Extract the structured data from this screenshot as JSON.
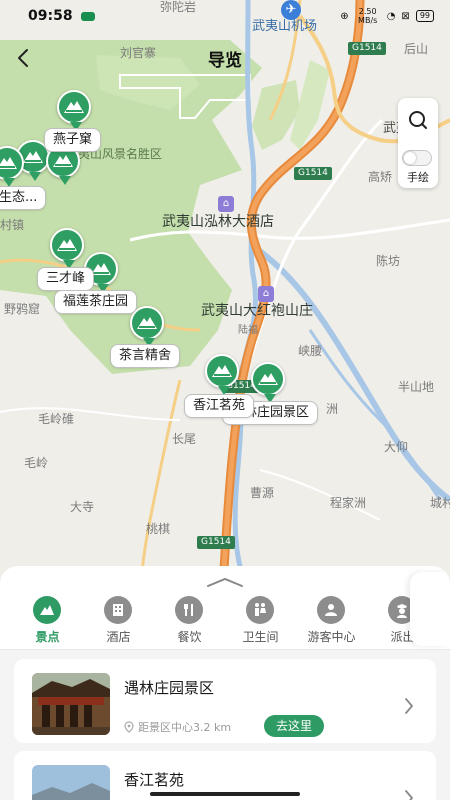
{
  "status_bar": {
    "time": "09:58",
    "net_speed": "2.50 MB/s",
    "battery": "99"
  },
  "header": {
    "title": "导览"
  },
  "tools": {
    "hand_label": "手绘"
  },
  "map": {
    "labels": {
      "mituo": "弥陀岩",
      "airport": "武夷山机场",
      "g1514": "G1514",
      "houshan": "后山",
      "liuguanzhai": "刘官寨",
      "wuyishan_right": "武夷山",
      "scenic_area": "夷山风景名胜区",
      "gaoqiao": "高矫",
      "hotel1": "武夷山泓林大酒店",
      "chenfang": "陈坊",
      "hotel2": "武夷山大红袍山庄",
      "yefengku": "野鸦窟",
      "xiayao": "峡腰",
      "banshandi": "半山地",
      "maolingdie": "毛岭碓",
      "changwei": "长尾",
      "zhou": "洲",
      "dayang": "大仰",
      "maoling": "毛岭",
      "caoyuan": "曹源",
      "chengjiazhou": "程家洲",
      "chengcun": "城村",
      "dasi": "大寺",
      "taoqi": "桃棋",
      "village": "村镇",
      "shengtai": "生态...",
      "lufu": "陆福"
    },
    "callouts": {
      "yanziku": "燕子窠",
      "sancaifeng": "三才峰",
      "fulian": "福莲茶庄园",
      "chayan": "茶言精舍",
      "xiangjiang": "香江茗苑",
      "yulin": "遇林庄园景区"
    }
  },
  "categories": [
    {
      "label": "景点",
      "icon": "scenic-icon",
      "active": true
    },
    {
      "label": "酒店",
      "icon": "hotel-icon",
      "active": false
    },
    {
      "label": "餐饮",
      "icon": "dining-icon",
      "active": false
    },
    {
      "label": "卫生间",
      "icon": "restroom-icon",
      "active": false
    },
    {
      "label": "游客中心",
      "icon": "visitor-center-icon",
      "active": false
    },
    {
      "label": "派出",
      "icon": "police-icon",
      "active": false
    }
  ],
  "cards": [
    {
      "name": "遇林庄园景区",
      "distance": "距景区中心3.2 km",
      "action": "去这里"
    },
    {
      "name": "香江茗苑",
      "distance": "",
      "action": ""
    }
  ],
  "colors": {
    "accent": "#2f9b64",
    "road": "#e88a3c"
  }
}
